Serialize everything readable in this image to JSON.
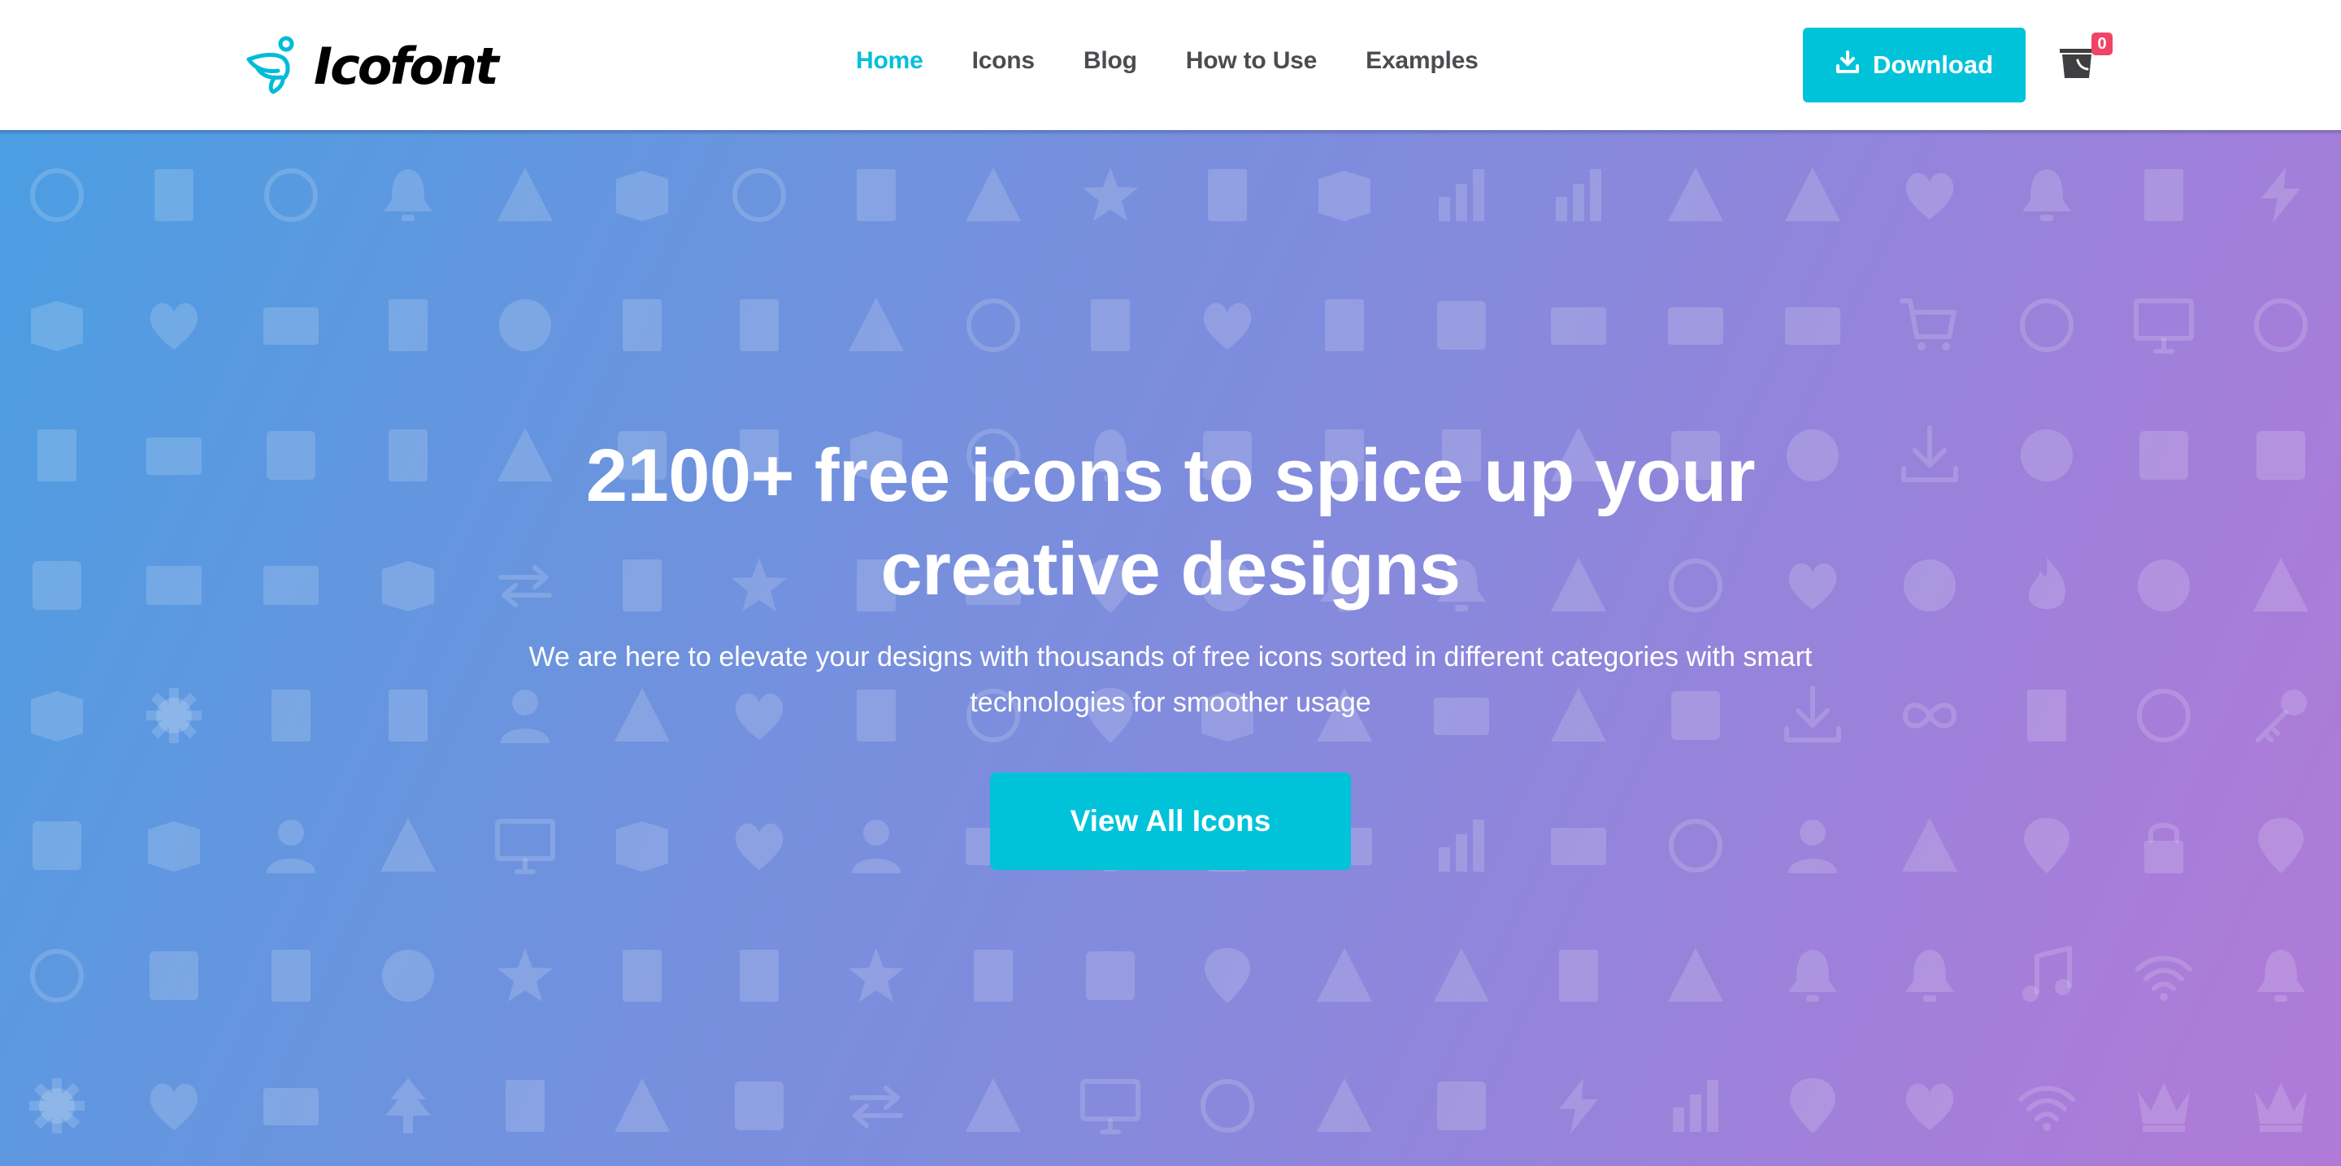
{
  "brand": {
    "name": "Icofont",
    "logo_icon": "winged-figure-icon",
    "accent_color": "#00c3da",
    "text_color": "#000000"
  },
  "nav": {
    "items": [
      {
        "label": "Home",
        "active": true
      },
      {
        "label": "Icons",
        "active": false
      },
      {
        "label": "Blog",
        "active": false
      },
      {
        "label": "How to Use",
        "active": false
      },
      {
        "label": "Examples",
        "active": false
      }
    ],
    "active_color": "#00c0d9",
    "inactive_color": "#4a4c50"
  },
  "header_actions": {
    "download_label": "Download",
    "download_icon": "download-icon",
    "cart_icon": "bucket-cart-icon",
    "cart_count": "0",
    "badge_color": "#ef4466"
  },
  "hero": {
    "title": "2100+ free icons to spice up your creative designs",
    "subtitle": "We are here to elevate your designs with thousands of free icons sorted in different categories with smart technologies for smoother usage",
    "cta_label": "View All Icons",
    "gradient_colors": [
      "#4b9ee2",
      "#8a88dc",
      "#b07bd8"
    ]
  },
  "background_icons": [
    [
      "plug-power",
      "address-book",
      "contrast",
      "bell",
      "anchor",
      "archive-box",
      "at-sign",
      "document-clip",
      "volume",
      "award-ribbon",
      "bag",
      "bank",
      "barcode",
      "bar-chart",
      "beach-umbrella",
      "flask",
      "bear",
      "alarm-bell",
      "trash",
      "bluetooth"
    ],
    [
      "open-box",
      "brain",
      "briefcase",
      "bucket",
      "bug",
      "building",
      "bullet",
      "megaphone",
      "target",
      "bus",
      "butterfly",
      "calculator",
      "calendar",
      "camera",
      "car",
      "id-card",
      "shopping-cart",
      "clock",
      "monitor",
      "compass"
    ],
    [
      "paint-bucket",
      "taxi",
      "code-window",
      "mug",
      "network-nodes",
      "chat-bubble",
      "documents",
      "cube",
      "donut",
      "food-cover",
      "browser-chart",
      "server",
      "database",
      "diamond",
      "dice",
      "disc",
      "download",
      "globe",
      "edit-square",
      "eject"
    ],
    [
      "eject",
      "email-at",
      "envelope",
      "eraser",
      "exchange-arrows",
      "exclamation",
      "star",
      "film-strip",
      "dumbbell",
      "pin",
      "moon",
      "bell-ring",
      "hat",
      "flask",
      "crosshair",
      "footprints",
      "soccer-ball",
      "flame",
      "football",
      "joystick"
    ],
    [
      "gavel",
      "gear",
      "spray-can",
      "shopping-bag",
      "group",
      "hammer",
      "hand",
      "coffee-cup",
      "anchor-cycle",
      "lightbulb",
      "house",
      "cutter",
      "bed",
      "hourglass",
      "image",
      "inbox-download",
      "infinity",
      "jacket",
      "ring",
      "key"
    ],
    [
      "keyhole",
      "keyboard",
      "girl",
      "lamp",
      "laptop",
      "layers",
      "leaf",
      "reading-person",
      "briefcase",
      "globe",
      "paper",
      "ticket",
      "books",
      "certificate",
      "lifebuoy",
      "support-agent",
      "navigation-arrow",
      "map-pin",
      "padlock",
      "lollipop"
    ],
    [
      "search-eye",
      "loop-arrows",
      "luggage",
      "dinner-plate",
      "magic-wand",
      "folded-map",
      "tablet-formula",
      "medal",
      "microphone",
      "cpu-chip",
      "singer-mic",
      "microscope",
      "windmill",
      "mobile-phone",
      "molecule",
      "money-bag",
      "cupcake",
      "music-note",
      "broadcast-tower",
      "bell-tilted"
    ],
    [
      "gear",
      "paw",
      "pie",
      "pine-tree",
      "power-plug",
      "pyramid",
      "puzzle",
      "shuffle",
      "recycle",
      "devices",
      "refresh",
      "tools",
      "robot",
      "rocket",
      "sliders",
      "pushpin",
      "thumbs-up",
      "wifi",
      "crown",
      "crown"
    ]
  ]
}
